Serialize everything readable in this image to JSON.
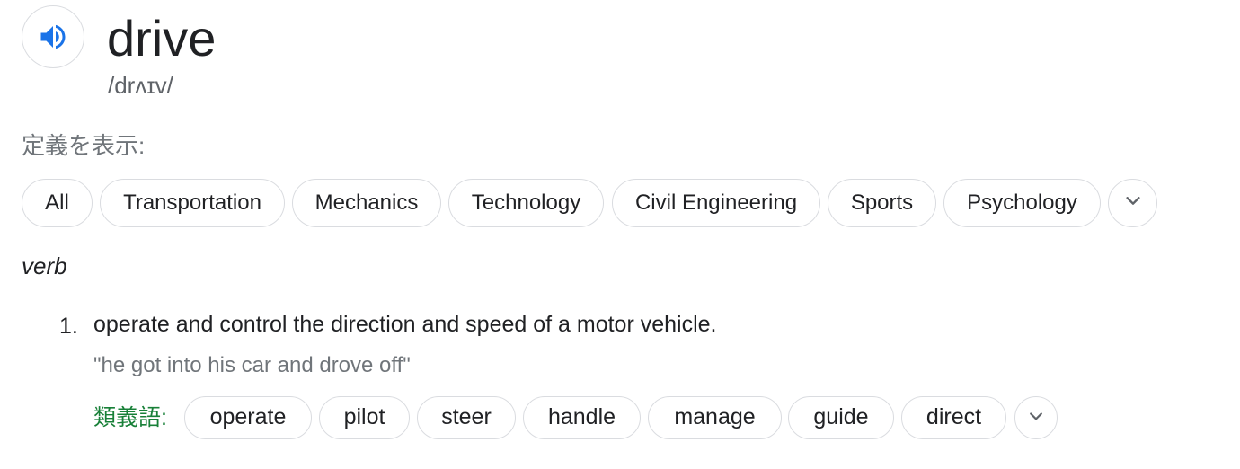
{
  "entry": {
    "word": "drive",
    "phonetic": "/drʌɪv/",
    "audio_icon": "speaker-icon"
  },
  "show_definitions_label": "定義を表示:",
  "categories": [
    {
      "label": "All"
    },
    {
      "label": "Transportation"
    },
    {
      "label": "Mechanics"
    },
    {
      "label": "Technology"
    },
    {
      "label": "Civil Engineering"
    },
    {
      "label": "Sports"
    },
    {
      "label": "Psychology"
    }
  ],
  "categories_more_icon": "chevron-down-icon",
  "part_of_speech": "verb",
  "senses": [
    {
      "number": "1.",
      "definition": "operate and control the direction and speed of a motor vehicle.",
      "example": "\"he got into his car and drove off\"",
      "synonyms_label": "類義語:",
      "synonyms": [
        "operate",
        "pilot",
        "steer",
        "handle",
        "manage",
        "guide",
        "direct"
      ],
      "synonyms_more_icon": "chevron-down-icon"
    }
  ],
  "colors": {
    "accent_blue": "#1a73e8",
    "synonym_label_green": "#188038",
    "chip_border": "#dadce0",
    "muted_text": "#70757a"
  }
}
